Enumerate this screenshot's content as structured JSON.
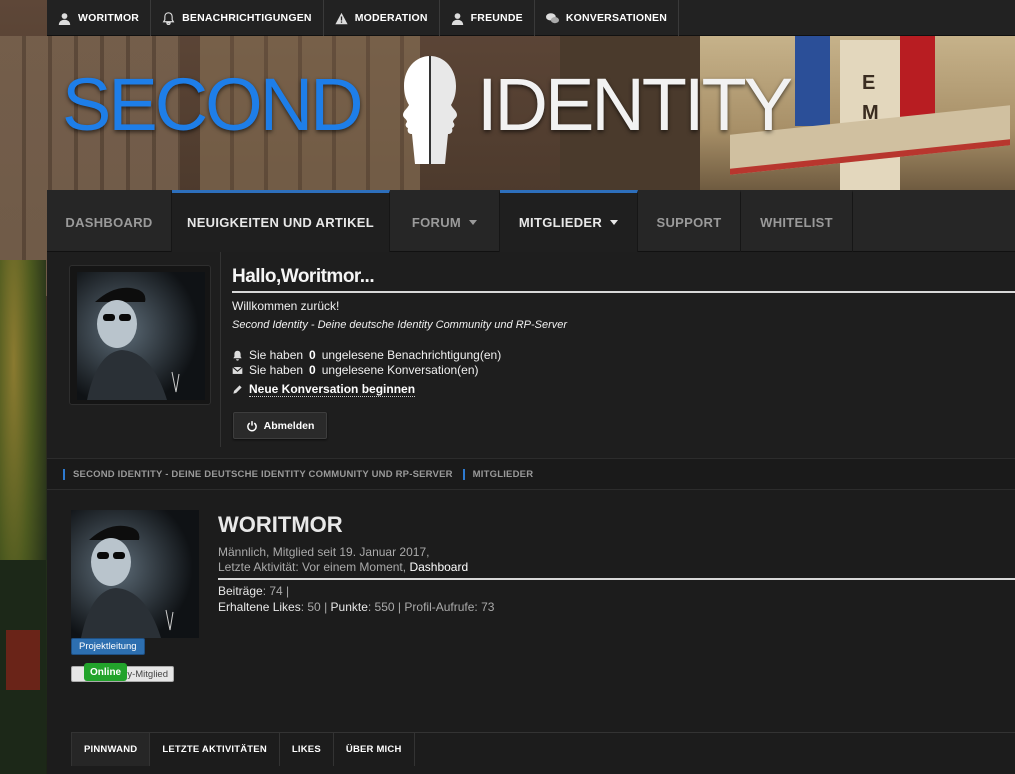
{
  "topbar": {
    "items": [
      {
        "label": "WORITMOR",
        "icon": "user-icon"
      },
      {
        "label": "BENACHRICHTIGUNGEN",
        "icon": "bell-icon"
      },
      {
        "label": "MODERATION",
        "icon": "warning-icon"
      },
      {
        "label": "FREUNDE",
        "icon": "user-icon"
      },
      {
        "label": "KONVERSATIONEN",
        "icon": "chat-icon"
      }
    ]
  },
  "logo": {
    "left": "SECOND",
    "right": "IDENTITY"
  },
  "nav": {
    "tabs": [
      {
        "label": "DASHBOARD"
      },
      {
        "label": "NEUIGKEITEN UND ARTIKEL"
      },
      {
        "label": "FORUM"
      },
      {
        "label": "MITGLIEDER"
      },
      {
        "label": "SUPPORT"
      },
      {
        "label": "WHITELIST"
      }
    ]
  },
  "welcome": {
    "title": "Hallo,Woritmor...",
    "greeting": "Willkommen zurück!",
    "slogan": "Second Identity - Deine deutsche Identity Community und RP-Server",
    "notifications_pre": "Sie haben",
    "notifications_count": "0",
    "notifications_post": "ungelesene Benachrichtigung(en)",
    "conversations_pre": "Sie haben",
    "conversations_count": "0",
    "conversations_post": "ungelesene Konversation(en)",
    "new_conversation": "Neue Konversation beginnen",
    "logout": "Abmelden"
  },
  "breadcrumb": {
    "items": [
      "SECOND IDENTITY - DEINE DEUTSCHE IDENTITY COMMUNITY UND RP-SERVER",
      "MITGLIEDER"
    ]
  },
  "profile": {
    "username": "WORITMOR",
    "meta1": "Männlich, Mitglied seit 19. Januar 2017,",
    "meta2_pre": "Letzte Aktivität: Vor einem Moment,",
    "meta2_link": "Dashboard",
    "posts_label": "Beiträge",
    "posts_value": ": 74",
    "likes_label": "Erhaltene Likes",
    "likes_value": ": 50",
    "points_label": "Punkte",
    "points_value": ": 550",
    "views_label": "Profil-Aufrufe",
    "views_value": ": 73",
    "rank": "Projektleitung",
    "group": "y-Mitglied",
    "online": "Online"
  },
  "profile_tabs": [
    "PINNWAND",
    "LETZTE AKTIVITÄTEN",
    "LIKES",
    "ÜBER MICH"
  ],
  "colors": {
    "accent": "#2d6fbc",
    "logo_blue": "#1e7ee8",
    "online": "#22a32b",
    "rank": "#2d6fb0"
  }
}
